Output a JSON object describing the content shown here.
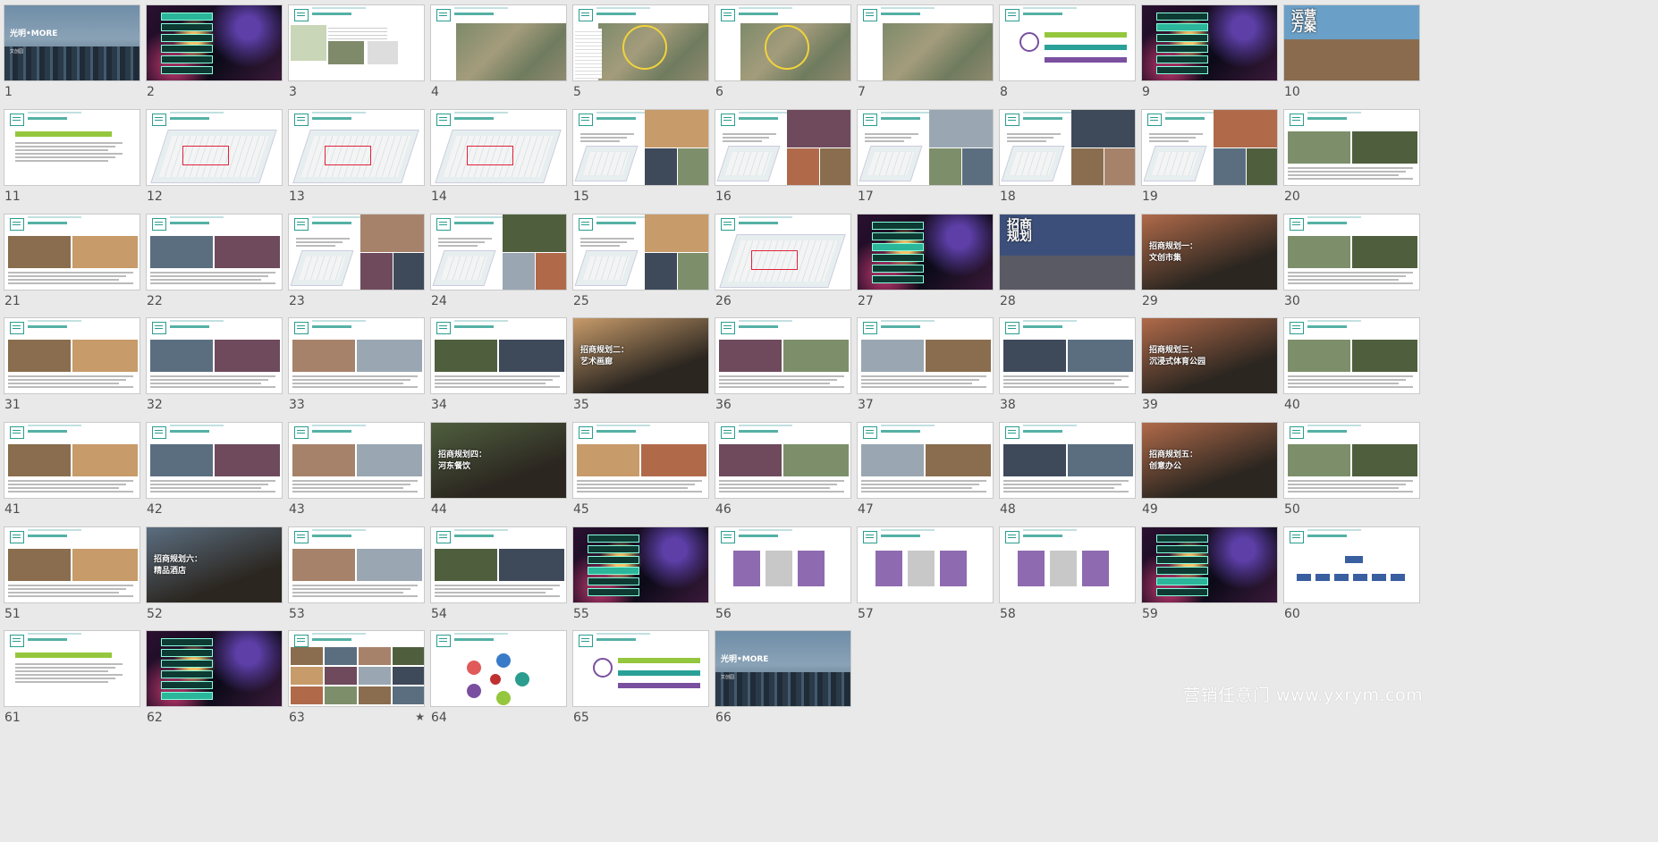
{
  "slide_sorter": {
    "slides": [
      {
        "n": "1",
        "kind": "cover",
        "title": "光明•MORE",
        "subtitle": "文创园"
      },
      {
        "n": "2",
        "kind": "menu",
        "active": 0
      },
      {
        "n": "3",
        "kind": "white-map"
      },
      {
        "n": "4",
        "kind": "map"
      },
      {
        "n": "5",
        "kind": "map-ring"
      },
      {
        "n": "6",
        "kind": "map-ring"
      },
      {
        "n": "7",
        "kind": "map"
      },
      {
        "n": "8",
        "kind": "diagram-bars"
      },
      {
        "n": "9",
        "kind": "menu",
        "active": 1
      },
      {
        "n": "10",
        "kind": "section",
        "title": "运营\n方案"
      },
      {
        "n": "11",
        "kind": "white-text"
      },
      {
        "n": "12",
        "kind": "plan"
      },
      {
        "n": "13",
        "kind": "plan"
      },
      {
        "n": "14",
        "kind": "plan"
      },
      {
        "n": "15",
        "kind": "plan-photo"
      },
      {
        "n": "16",
        "kind": "plan-photo"
      },
      {
        "n": "17",
        "kind": "plan-photo"
      },
      {
        "n": "18",
        "kind": "plan-photo"
      },
      {
        "n": "19",
        "kind": "plan-photo"
      },
      {
        "n": "20",
        "kind": "white-photos"
      },
      {
        "n": "21",
        "kind": "white-photos"
      },
      {
        "n": "22",
        "kind": "white-photos"
      },
      {
        "n": "23",
        "kind": "plan-photo"
      },
      {
        "n": "24",
        "kind": "plan-photo"
      },
      {
        "n": "25",
        "kind": "plan-photo"
      },
      {
        "n": "26",
        "kind": "plan"
      },
      {
        "n": "27",
        "kind": "menu",
        "active": 2
      },
      {
        "n": "28",
        "kind": "section",
        "title": "招商\n规划"
      },
      {
        "n": "29",
        "kind": "section",
        "title": "招商规划一：\n文创市集"
      },
      {
        "n": "30",
        "kind": "white-photos"
      },
      {
        "n": "31",
        "kind": "white-photos"
      },
      {
        "n": "32",
        "kind": "white-photos"
      },
      {
        "n": "33",
        "kind": "white-photos"
      },
      {
        "n": "34",
        "kind": "white-photos"
      },
      {
        "n": "35",
        "kind": "section",
        "title": "招商规划二：\n艺术画廊"
      },
      {
        "n": "36",
        "kind": "white-photos"
      },
      {
        "n": "37",
        "kind": "white-photos"
      },
      {
        "n": "38",
        "kind": "white-photos"
      },
      {
        "n": "39",
        "kind": "section",
        "title": "招商规划三：\n沉浸式体育公园"
      },
      {
        "n": "40",
        "kind": "white-photos"
      },
      {
        "n": "41",
        "kind": "white-photos"
      },
      {
        "n": "42",
        "kind": "white-photos"
      },
      {
        "n": "43",
        "kind": "white-photos"
      },
      {
        "n": "44",
        "kind": "section",
        "title": "招商规划四：\n河东餐饮"
      },
      {
        "n": "45",
        "kind": "white-photos"
      },
      {
        "n": "46",
        "kind": "white-photos"
      },
      {
        "n": "47",
        "kind": "white-photos"
      },
      {
        "n": "48",
        "kind": "white-photos"
      },
      {
        "n": "49",
        "kind": "section",
        "title": "招商规划五：\n创意办公"
      },
      {
        "n": "50",
        "kind": "white-photos"
      },
      {
        "n": "51",
        "kind": "white-photos"
      },
      {
        "n": "52",
        "kind": "section",
        "title": "招商规划六：\n精品酒店"
      },
      {
        "n": "53",
        "kind": "white-photos"
      },
      {
        "n": "54",
        "kind": "white-photos"
      },
      {
        "n": "55",
        "kind": "menu",
        "active": 3
      },
      {
        "n": "56",
        "kind": "cards"
      },
      {
        "n": "57",
        "kind": "cards"
      },
      {
        "n": "58",
        "kind": "cards"
      },
      {
        "n": "59",
        "kind": "menu",
        "active": 4
      },
      {
        "n": "60",
        "kind": "org"
      },
      {
        "n": "61",
        "kind": "white-text"
      },
      {
        "n": "62",
        "kind": "menu",
        "active": 5
      },
      {
        "n": "63",
        "kind": "grid",
        "star": "★"
      },
      {
        "n": "64",
        "kind": "cycle"
      },
      {
        "n": "65",
        "kind": "diagram-bars"
      },
      {
        "n": "66",
        "kind": "cover",
        "title": "光明•MORE",
        "subtitle": "文创园"
      }
    ]
  },
  "watermark": "营销任意门 www.yxrym.com",
  "colors": {
    "accent": "#2a9d8f",
    "lime": "#94c73d",
    "purple": "#7a4fa0",
    "background": "#e9e9e9"
  }
}
